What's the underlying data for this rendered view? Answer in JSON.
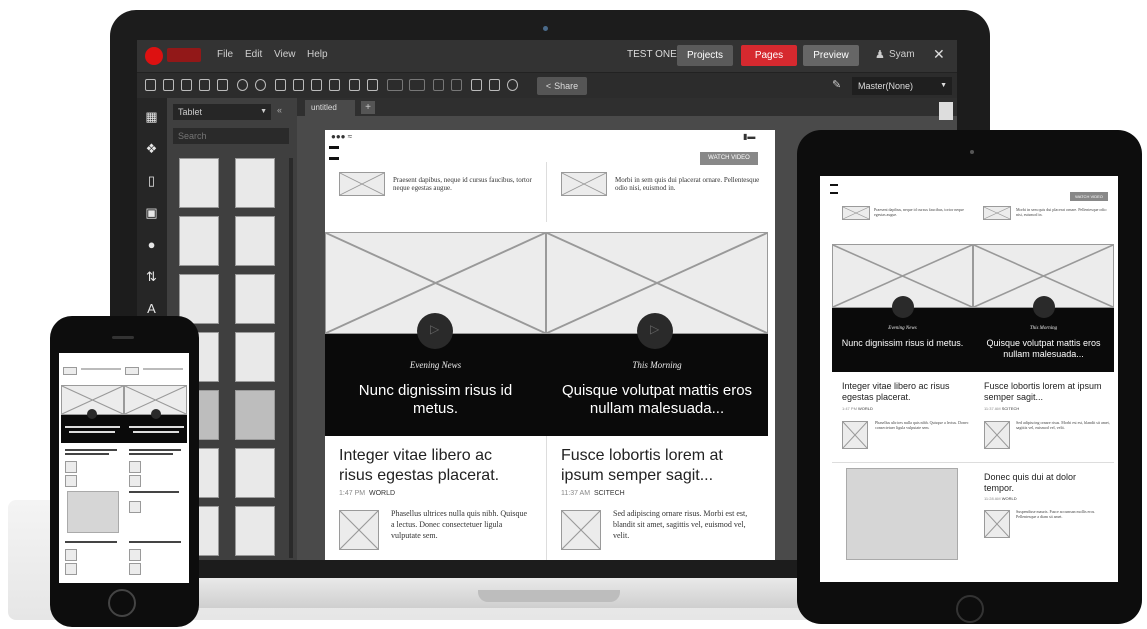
{
  "app": {
    "menu": [
      "File",
      "Edit",
      "View",
      "Help"
    ],
    "project_name": "TEST ONE",
    "projects_button": "Projects",
    "pages_button": "Pages",
    "preview_button": "Preview",
    "user": "Syam",
    "share_button": "Share",
    "master_select": "Master(None)",
    "panel_select": "Tablet",
    "search_placeholder": "Search",
    "tab_label": "untitled",
    "tab_add": "+",
    "colors": {
      "accent_red": "#d6292f",
      "chrome_dark": "#333333",
      "toolbar": "#2c2c2c"
    }
  },
  "wireframe": {
    "watch_video": "WATCH VIDEO",
    "intro_left": "Praesent dapibus, neque id cursus faucibus, tortor neque egestas augue.",
    "intro_right": "Morbi in sem quis dui placerat ornare. Pellentesque odio nisi, euismod in.",
    "feature_left": {
      "kicker": "Evening News",
      "headline": "Nunc dignissim risus id metus."
    },
    "feature_right": {
      "kicker": "This Morning",
      "headline": "Quisque volutpat mattis eros nullam malesuada..."
    },
    "story_left": {
      "headline": "Integer vitae libero ac risus egestas placerat.",
      "time": "1:47 PM",
      "section": "WORLD",
      "body": "Phasellus ultrices nulla quis nibh. Quisque a lectus. Donec consectetuer ligula vulputate sem."
    },
    "story_right": {
      "headline": "Fusce lobortis lorem at ipsum semper sagit...",
      "time": "11:37 AM",
      "section": "SCITECH",
      "body": "Sed adipiscing ornare risus. Morbi est est, blandit sit amet, sagittis vel, euismod vel, velit."
    },
    "story_third": {
      "headline": "Donec quis dui at dolor tempor.",
      "time": "11:28 AM",
      "section": "WORLD",
      "body": "Suspendisse mauris. Fusce accumsan mollis eros. Pellentesque a diam sit amet."
    }
  }
}
